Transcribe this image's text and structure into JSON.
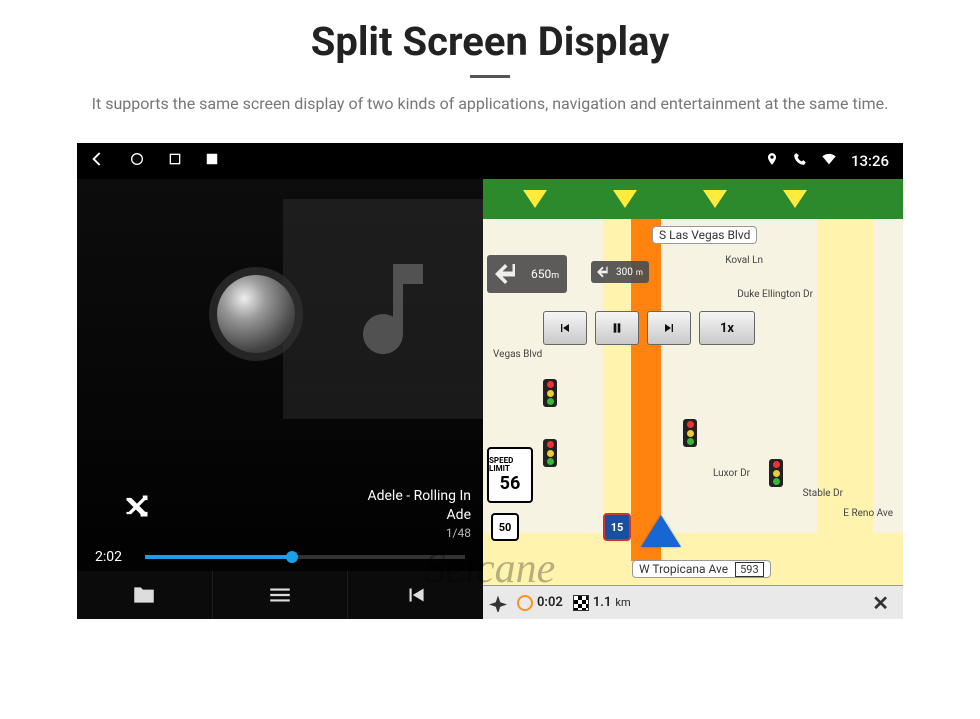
{
  "page": {
    "title": "Split Screen Display",
    "subtitle": "It supports the same screen display of two kinds of applications, navigation and entertainment at the same time."
  },
  "statusbar": {
    "clock": "13:26"
  },
  "player": {
    "track_title": "Adele - Rolling In",
    "track_artist": "Ade",
    "track_index": "1/48",
    "elapsed": "2:02"
  },
  "nav": {
    "street_top": "S Las Vegas Blvd",
    "street_bottom": "W Tropicana Ave",
    "street_bottom_num": "593",
    "turn_distance": "650",
    "turn_unit": "m",
    "next_turn_distance": "300",
    "next_turn_unit": "m",
    "playback_speed": "1x",
    "speed_limit_label": "SPEED LIMIT",
    "speed_limit_value": "56",
    "shield_us": "50",
    "shield_interstate": "15",
    "poi_1": "Duke Ellington Dr",
    "poi_2": "Koval Ln",
    "poi_3": "Stable Dr",
    "poi_4": "E Reno Ave",
    "poi_5": "Luxor Dr",
    "poi_6": "Vegas Blvd",
    "eta_time": "0:02",
    "eta_dist_value": "1.1",
    "eta_dist_unit": "km"
  },
  "watermark": "Seicane"
}
